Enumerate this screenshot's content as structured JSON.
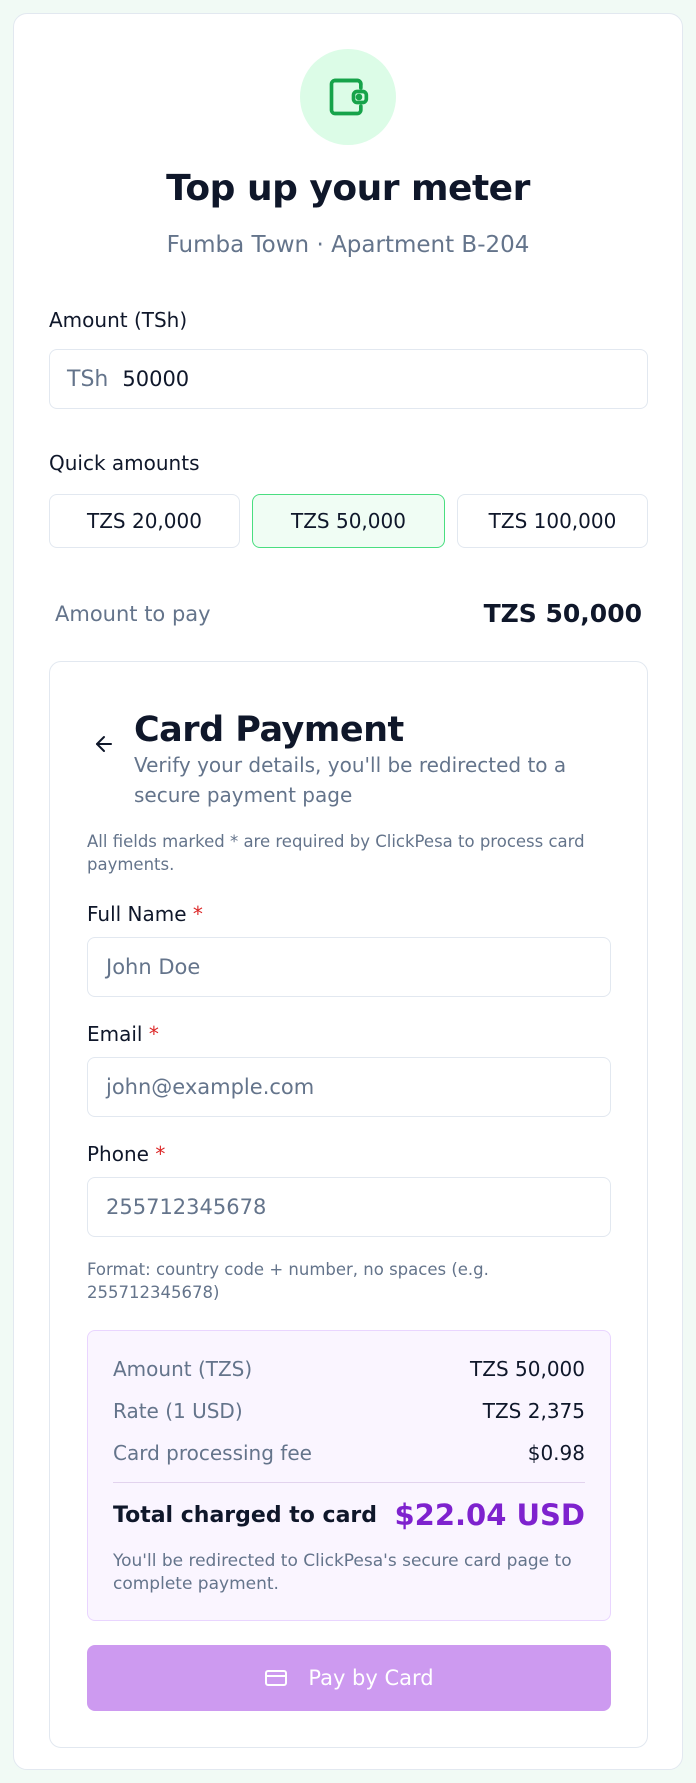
{
  "header": {
    "icon": "wallet-icon",
    "title": "Top up your meter",
    "subtitle": "Fumba Town · Apartment B-204"
  },
  "amount": {
    "label": "Amount (TSh)",
    "prefix": "TSh",
    "value": "50000"
  },
  "quick_amounts": {
    "label": "Quick amounts",
    "options": [
      "TZS 20,000",
      "TZS 50,000",
      "TZS 100,000"
    ],
    "selected": "TZS 50,000"
  },
  "amount_to_pay": {
    "label": "Amount to pay",
    "value": "TZS 50,000"
  },
  "card_payment": {
    "back_icon": "arrow-left-icon",
    "title": "Card Payment",
    "subtitle": "Verify your details, you'll be redirected to a secure payment page",
    "note": "All fields marked * are required by ClickPesa to process card payments.",
    "required_marker": "*",
    "fields": {
      "full_name": {
        "label": "Full Name",
        "placeholder": "John Doe"
      },
      "email": {
        "label": "Email",
        "placeholder": "john@example.com"
      },
      "phone": {
        "label": "Phone",
        "placeholder": "255712345678"
      }
    },
    "phone_hint": "Format: country code + number, no spaces (e.g. 255712345678)",
    "summary": {
      "rows": [
        {
          "label": "Amount (TZS)",
          "value": "TZS 50,000"
        },
        {
          "label": "Rate (1 USD)",
          "value": "TZS 2,375"
        },
        {
          "label": "Card processing fee",
          "value": "$0.98"
        }
      ],
      "total_label": "Total charged to card",
      "total_value": "$22.04 USD",
      "note": "You'll be redirected to ClickPesa's secure card page to complete payment."
    },
    "pay_button": {
      "icon": "credit-card-icon",
      "label": "Pay by Card"
    }
  },
  "colors": {
    "accent_green": "#16a34a",
    "accent_purple": "#7e22ce",
    "button_purple": "#cd9af0",
    "required_red": "#dc2626"
  }
}
